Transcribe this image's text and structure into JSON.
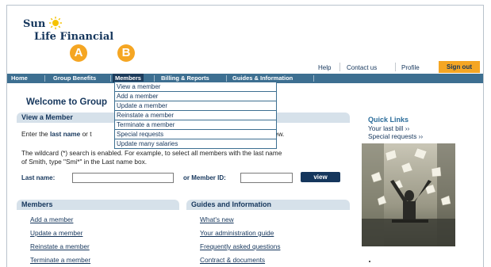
{
  "logo": {
    "line1": "Sun",
    "line2": "Life Financial"
  },
  "utility": {
    "help": "Help",
    "contact": "Contact us",
    "profile": "Profile",
    "signout": "Sign out"
  },
  "nav": {
    "home": "Home",
    "group_benefits": "Group Benefits",
    "members": "Members",
    "billing": "Billing & Reports",
    "guides": "Guides & Information"
  },
  "badges": {
    "a": "A",
    "b": "B"
  },
  "welcome": "Welcome to Group",
  "view_member": {
    "title": "View a Member",
    "instr_pre": "Enter the ",
    "instr_bold": "last name",
    "instr_post": " or t",
    "instr_tail": "iew.",
    "wildcard_line1": "The wildcard (*) search is enabled. For example, to select all members with the last name",
    "wildcard_line2": "of Smith, type \"Smi*\" in the Last name box.",
    "last_name_label": "Last name:",
    "member_id_label": "or Member ID:",
    "view_button": "view"
  },
  "dropdown": [
    "View a member",
    "Add a member",
    "Update a member",
    "Reinstate a member",
    "Terminate a member",
    "Special requests",
    "Update many salaries"
  ],
  "members_panel": {
    "title": "Members",
    "links": [
      "Add a member",
      "Update a member",
      "Reinstate a member",
      "Terminate a member"
    ]
  },
  "guides_panel": {
    "title": "Guides and Information",
    "links": [
      "What's new",
      "Your administration guide",
      "Frequently asked questions",
      "Contract & documents"
    ]
  },
  "quick_links": {
    "title": "Quick Links",
    "items": [
      "Your last bill ››",
      "Special requests ››"
    ]
  },
  "colors": {
    "brand_navy": "#15365c",
    "nav_blue": "#3d6f91",
    "accent_orange": "#f5a623",
    "panel_tint": "#d6e1ea"
  }
}
